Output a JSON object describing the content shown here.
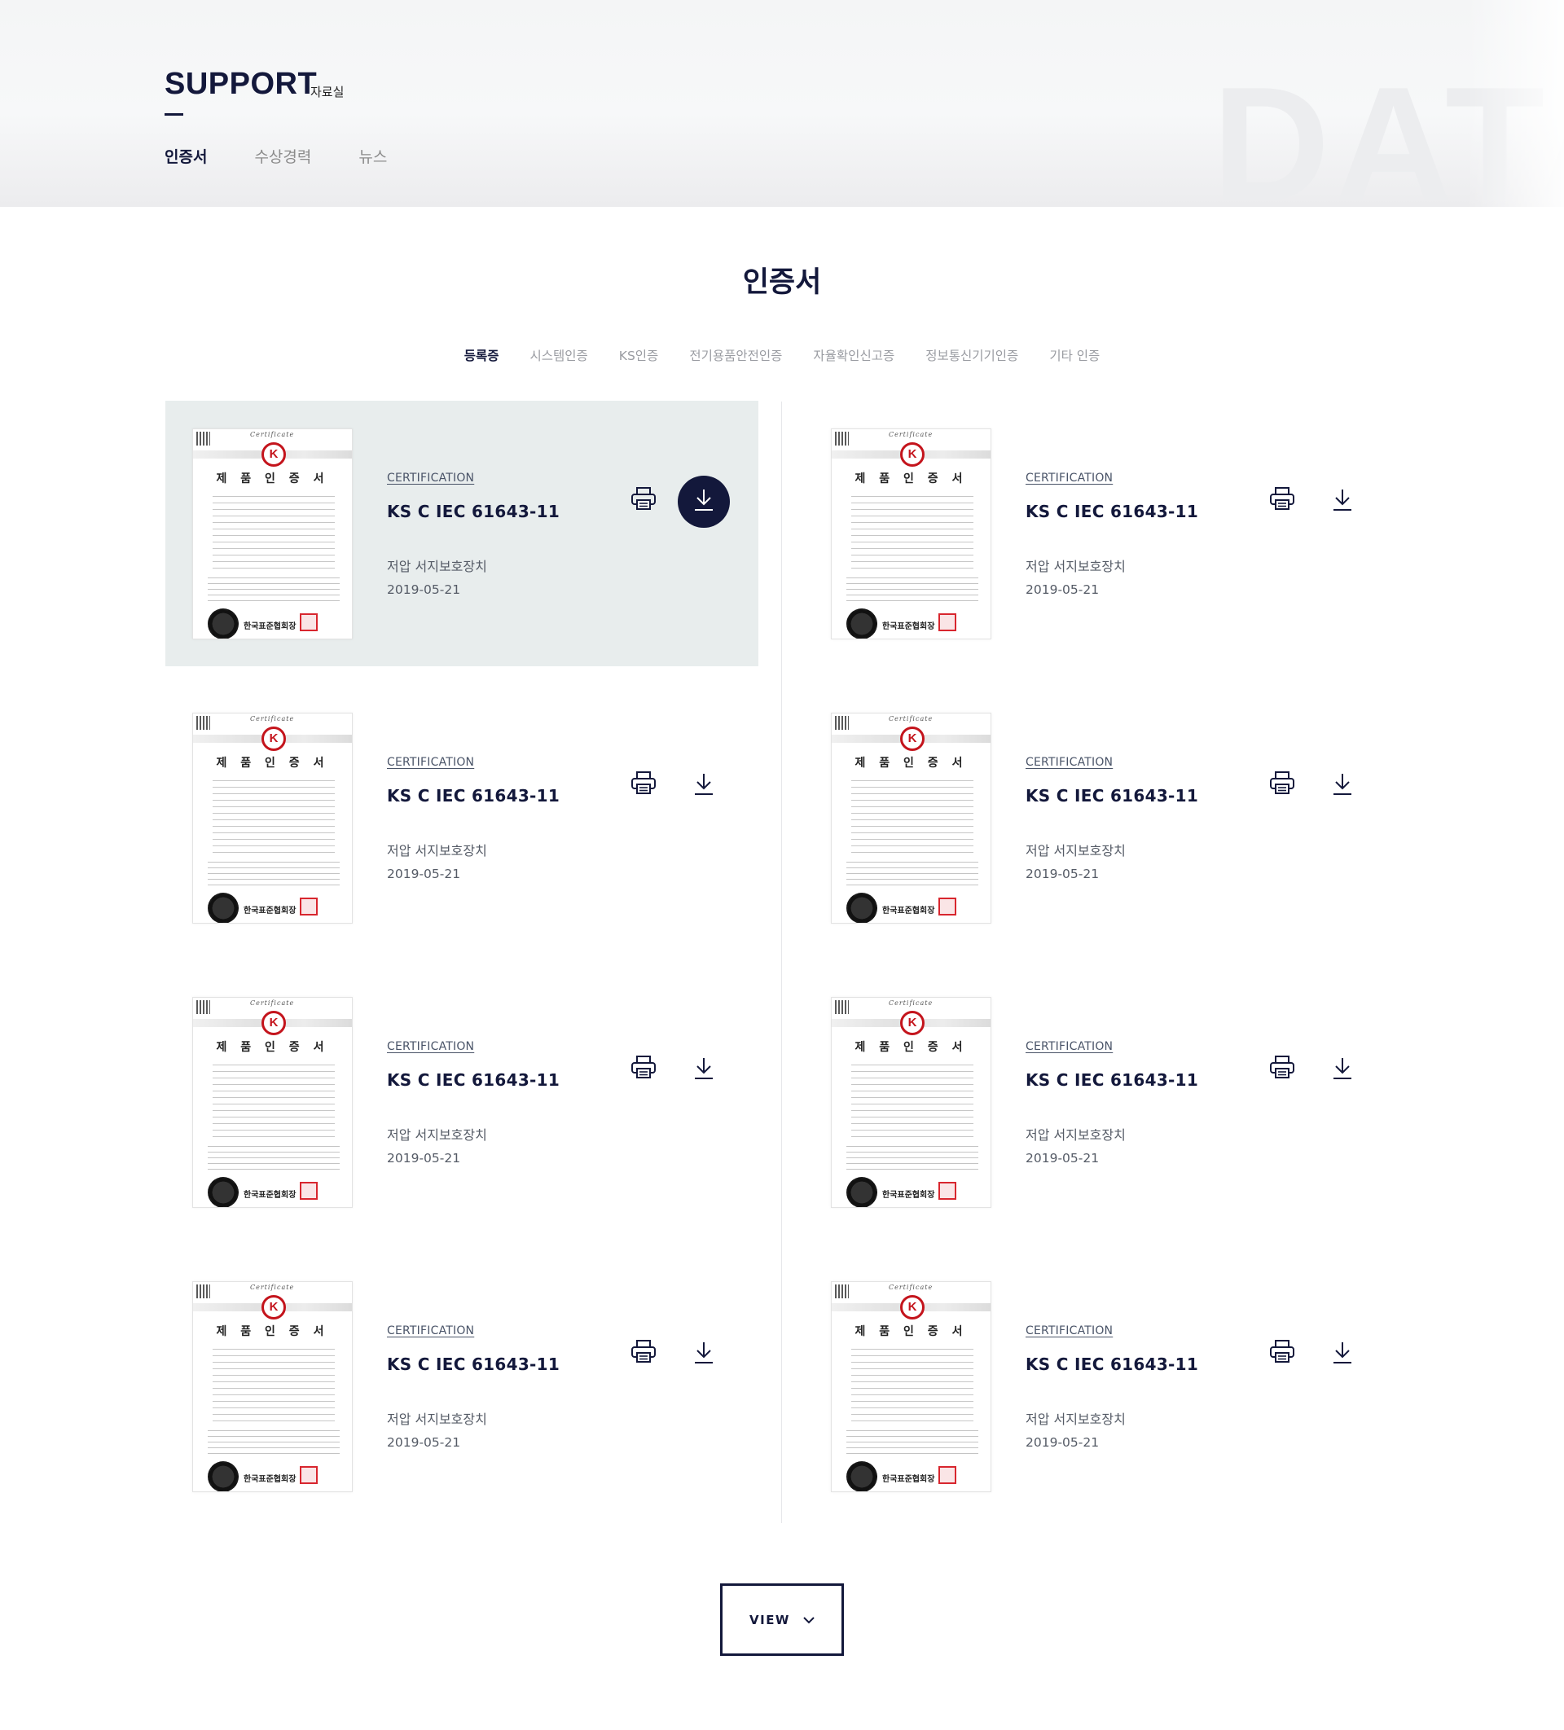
{
  "header": {
    "title": "SUPPORT",
    "subtitle": "자료실",
    "background_word": "DATA",
    "tabs": [
      {
        "label": "인증서",
        "active": true
      },
      {
        "label": "수상경력",
        "active": false
      },
      {
        "label": "뉴스",
        "active": false
      }
    ]
  },
  "section": {
    "title": "인증서",
    "categories": [
      {
        "label": "등록증",
        "active": true
      },
      {
        "label": "시스템인증",
        "active": false
      },
      {
        "label": "KS인증",
        "active": false
      },
      {
        "label": "전기용품안전인증",
        "active": false
      },
      {
        "label": "자율확인신고증",
        "active": false
      },
      {
        "label": "정보통신기기인증",
        "active": false
      },
      {
        "label": "기타 인증",
        "active": false
      }
    ]
  },
  "thumbnail": {
    "cert_word": "Certificate",
    "logo_text": "K",
    "doc_title": "제 품 인 증 서",
    "org_name": "한국표준협회장"
  },
  "items": [
    {
      "eyebrow": "CERTIFICATION",
      "model": "KS C IEC 61643-11",
      "product": "저압 서지보호장치",
      "date": "2019-05-21",
      "hovered": true
    },
    {
      "eyebrow": "CERTIFICATION",
      "model": "KS C IEC 61643-11",
      "product": "저압 서지보호장치",
      "date": "2019-05-21",
      "hovered": false
    },
    {
      "eyebrow": "CERTIFICATION",
      "model": "KS C IEC 61643-11",
      "product": "저압 서지보호장치",
      "date": "2019-05-21",
      "hovered": false
    },
    {
      "eyebrow": "CERTIFICATION",
      "model": "KS C IEC 61643-11",
      "product": "저압 서지보호장치",
      "date": "2019-05-21",
      "hovered": false
    },
    {
      "eyebrow": "CERTIFICATION",
      "model": "KS C IEC 61643-11",
      "product": "저압 서지보호장치",
      "date": "2019-05-21",
      "hovered": false
    },
    {
      "eyebrow": "CERTIFICATION",
      "model": "KS C IEC 61643-11",
      "product": "저압 서지보호장치",
      "date": "2019-05-21",
      "hovered": false
    },
    {
      "eyebrow": "CERTIFICATION",
      "model": "KS C IEC 61643-11",
      "product": "저압 서지보호장치",
      "date": "2019-05-21",
      "hovered": false
    },
    {
      "eyebrow": "CERTIFICATION",
      "model": "KS C IEC 61643-11",
      "product": "저압 서지보호장치",
      "date": "2019-05-21",
      "hovered": false
    }
  ],
  "icons": {
    "print": "printer-icon",
    "download": "download-icon",
    "view_more": "chevron-down-icon"
  },
  "colors": {
    "navy": "#13183b",
    "hover_bg": "#e8eded",
    "stamp_red": "#d8262e"
  },
  "view_button": {
    "label": "VIEW"
  }
}
